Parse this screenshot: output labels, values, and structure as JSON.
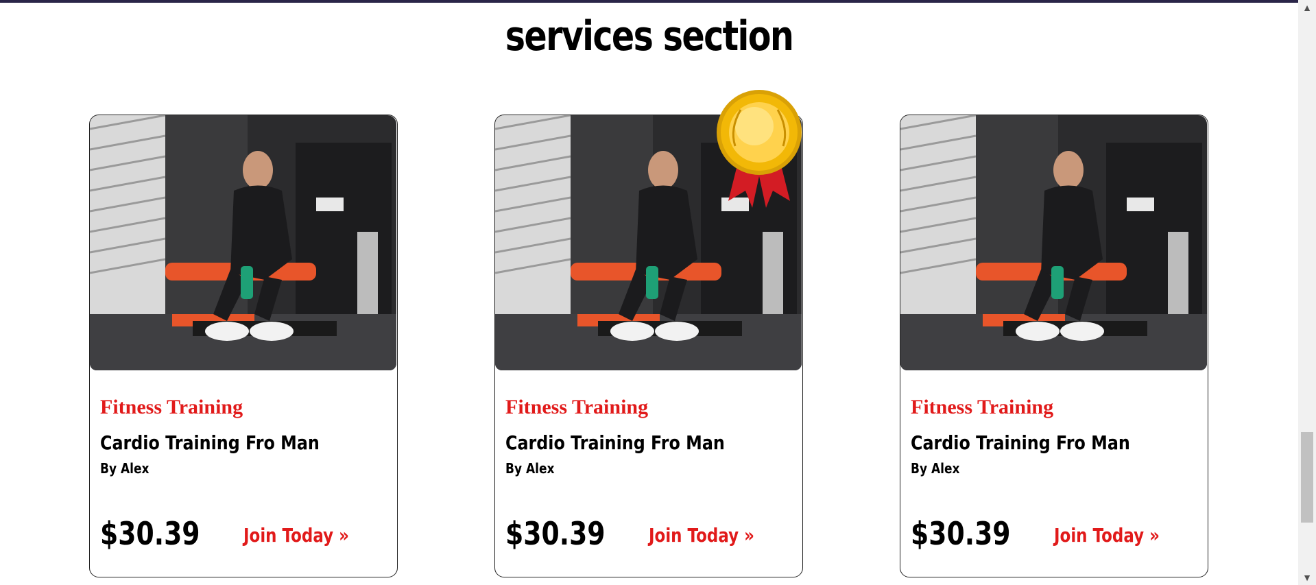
{
  "section": {
    "title": "services section"
  },
  "cards": [
    {
      "category": "Fitness Training",
      "title": "Cardio Training Fro Man",
      "author": "By Alex",
      "price": "$30.39",
      "cta": "Join Today »",
      "featured": false
    },
    {
      "category": "Fitness Training",
      "title": "Cardio Training Fro Man",
      "author": "By Alex",
      "price": "$30.39",
      "cta": "Join Today »",
      "featured": true
    },
    {
      "category": "Fitness Training",
      "title": "Cardio Training Fro Man",
      "author": "By Alex",
      "price": "$30.39",
      "cta": "Join Today »",
      "featured": false
    }
  ],
  "colors": {
    "accent": "#e11a1a",
    "top_bar": "#2a2548",
    "medal_gold": "#f2b807",
    "ribbon": "#d31c24"
  },
  "icons": {
    "medal": "gold-medal-icon",
    "scroll_up": "chevron-up-icon",
    "scroll_down": "chevron-down-icon"
  }
}
